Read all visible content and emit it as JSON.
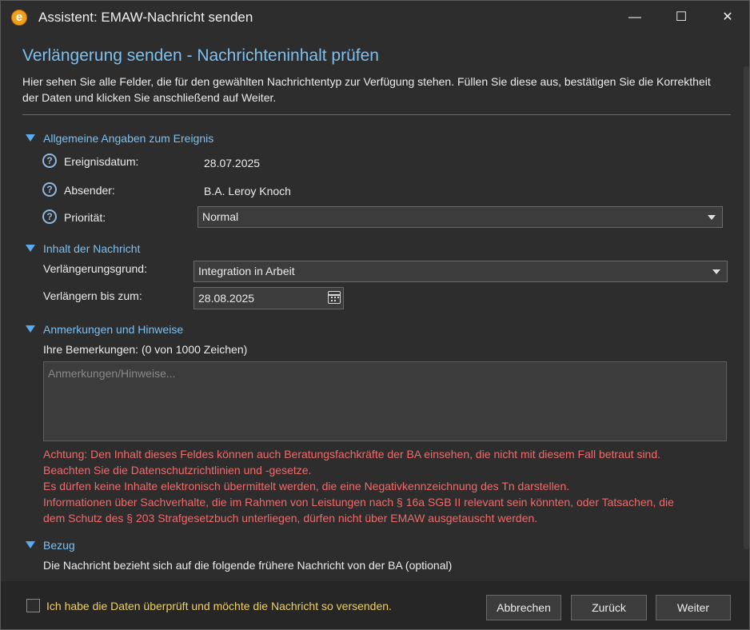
{
  "window": {
    "icon_letter": "e",
    "title": "Assistent: EMAW-Nachricht senden",
    "minimize": "—",
    "maximize": "☐",
    "close": "✕"
  },
  "page": {
    "heading": "Verlängerung senden - Nachrichteninhalt prüfen",
    "intro": "Hier sehen Sie alle Felder, die für den gewählten Nachrichtentyp zur Verfügung stehen. Füllen Sie diese aus, bestätigen Sie die Korrektheit der Daten und klicken Sie anschließend auf Weiter."
  },
  "general": {
    "title": "Allgemeine Angaben zum Ereignis",
    "event_date_label": "Ereignisdatum:",
    "event_date_value": "28.07.2025",
    "sender_label": "Absender:",
    "sender_value": "B.A. Leroy Knoch",
    "priority_label": "Priorität:",
    "priority_value": "Normal"
  },
  "content": {
    "title": "Inhalt der Nachricht",
    "reason_label": "Verlängerungsgrund:",
    "reason_value": "Integration in Arbeit",
    "extend_label": "Verlängern bis zum:",
    "extend_value": "28.08.2025"
  },
  "notes": {
    "title": "Anmerkungen und Hinweise",
    "remarks_label": "Ihre Bemerkungen: (0 von 1000 Zeichen)",
    "placeholder": "Anmerkungen/Hinweise...",
    "warnings": [
      "Achtung: Den Inhalt dieses Feldes können auch Beratungsfachkräfte der BA einsehen, die nicht mit diesem Fall betraut sind.",
      "Beachten Sie die Datenschutzrichtlinien und -gesetze.",
      "Es dürfen keine Inhalte elektronisch übermittelt werden, die eine Negativkennzeichnung des Tn darstellen.",
      "Informationen über Sachverhalte, die im Rahmen von Leistungen nach § 16a SGB II relevant sein könnten, oder Tatsachen, die",
      "dem Schutz des § 203 Strafgesetzbuch unterliegen, dürfen nicht über EMAW ausgetauscht werden."
    ]
  },
  "reference": {
    "title": "Bezug",
    "text": "Die Nachricht bezieht sich auf die folgende frühere Nachricht von der BA (optional)"
  },
  "footer": {
    "confirm_label": "Ich habe die Daten überprüft und möchte die Nachricht so versenden.",
    "cancel": "Abbrechen",
    "back": "Zurück",
    "next": "Weiter"
  },
  "colors": {
    "accent": "#7cc0f0",
    "warning": "#f06a6a",
    "confirm": "#f0d060"
  }
}
